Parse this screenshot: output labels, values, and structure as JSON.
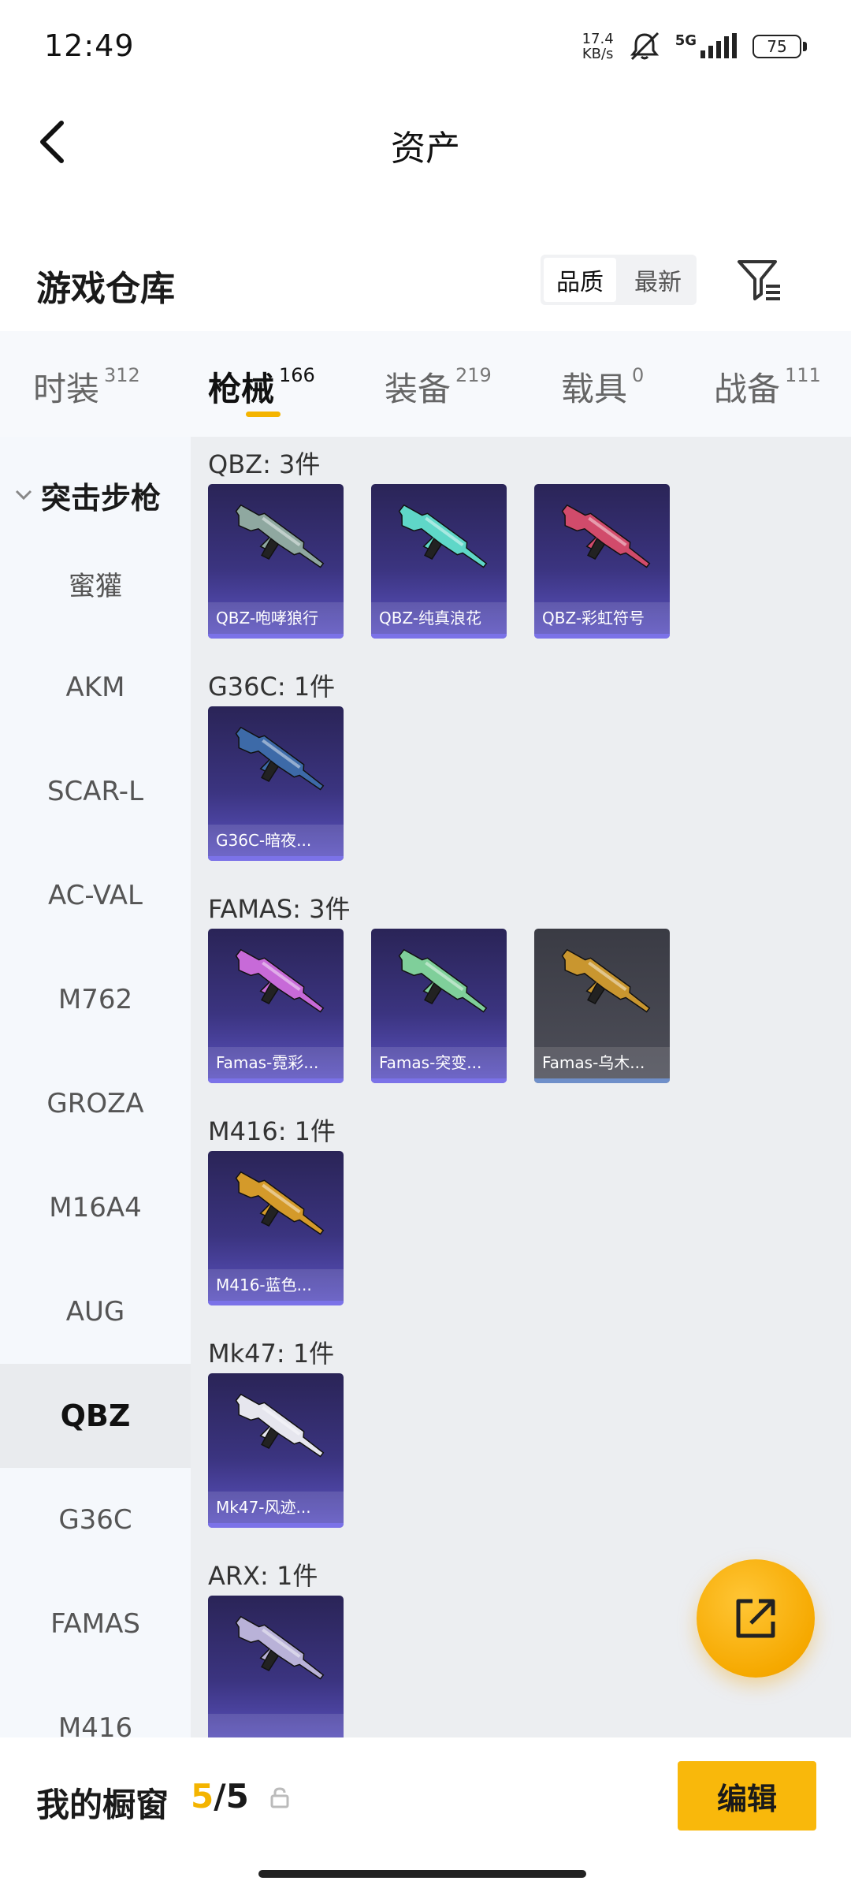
{
  "status_bar": {
    "time": "12:49",
    "net_speed_value": "17.4",
    "net_speed_unit": "KB/s",
    "network": "5G",
    "battery": "75"
  },
  "header": {
    "title": "资产"
  },
  "warehouse": {
    "title": "游戏仓库",
    "sort_options": [
      "品质",
      "最新"
    ],
    "active_sort": "品质"
  },
  "tabs": [
    {
      "label": "时装",
      "count": "312"
    },
    {
      "label": "枪械",
      "count": "166"
    },
    {
      "label": "装备",
      "count": "219"
    },
    {
      "label": "载具",
      "count": "0"
    },
    {
      "label": "战备",
      "count": "111"
    }
  ],
  "active_tab": "枪械",
  "sidebar": {
    "group": "突击步枪",
    "items": [
      "蜜獾",
      "AKM",
      "SCAR-L",
      "AC-VAL",
      "M762",
      "GROZA",
      "M16A4",
      "AUG",
      "QBZ",
      "G36C",
      "FAMAS",
      "M416"
    ],
    "active_item": "QBZ"
  },
  "groups": [
    {
      "title": "QBZ: 3件",
      "items": [
        {
          "name": "QBZ-咆哮狼行",
          "color": "#8fa8a0"
        },
        {
          "name": "QBZ-纯真浪花",
          "color": "#5fd7c8"
        },
        {
          "name": "QBZ-彩虹符号",
          "color": "#d14b6b"
        }
      ]
    },
    {
      "title": "G36C: 1件",
      "items": [
        {
          "name": "G36C-暗夜...",
          "color": "#3d6aa8"
        }
      ]
    },
    {
      "title": "FAMAS: 3件",
      "items": [
        {
          "name": "Famas-霓彩...",
          "color": "#c76ad8"
        },
        {
          "name": "Famas-突变...",
          "color": "#7fcf9a"
        },
        {
          "name": "Famas-乌木...",
          "color": "#c9962f"
        }
      ]
    },
    {
      "title": "M416: 1件",
      "items": [
        {
          "name": "M416-蓝色...",
          "color": "#d49a2a"
        }
      ]
    },
    {
      "title": "Mk47: 1件",
      "items": [
        {
          "name": "Mk47-风迹...",
          "color": "#e6e6ee"
        }
      ]
    },
    {
      "title": "ARX: 1件",
      "items": [
        {
          "name": "",
          "color": "#b9b2d8"
        }
      ]
    }
  ],
  "bottom": {
    "window_label": "我的橱窗",
    "window_current": "5",
    "window_separator": "/",
    "window_max": "5",
    "edit_label": "编辑"
  },
  "colors": {
    "accent": "#f4b400",
    "card_purple": "#3b3480",
    "card_grey": "#4e4f59"
  }
}
